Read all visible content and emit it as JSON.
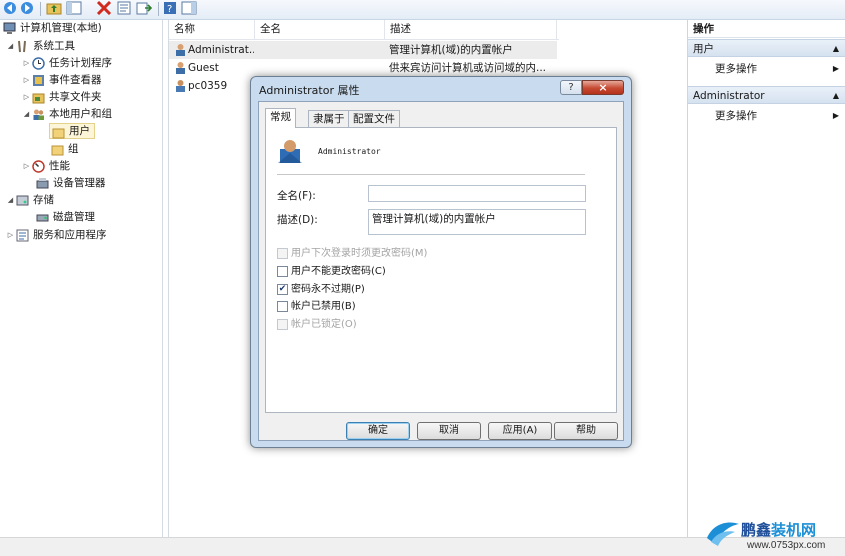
{
  "colors": {
    "selection_bg": "#fdf5d8",
    "action_group_bg": "#d6e2f0",
    "dialog_frame": "#c9dbee",
    "close_button": "#c64a32",
    "watermark_blue": "#1c8fd6"
  },
  "toolbar": {
    "icons": [
      "back-icon",
      "forward-icon",
      "up-folder-icon",
      "show-hide-tree-icon",
      "delete-icon",
      "properties-icon",
      "export-icon",
      "help-icon",
      "show-hide-action-pane-icon"
    ]
  },
  "tree": {
    "root": "计算机管理(本地)",
    "system_tools": "系统工具",
    "task_scheduler": "任务计划程序",
    "event_viewer": "事件查看器",
    "shared_folders": "共享文件夹",
    "local_users_groups": "本地用户和组",
    "users": "用户",
    "groups": "组",
    "performance": "性能",
    "device_manager": "设备管理器",
    "storage": "存储",
    "disk_management": "磁盘管理",
    "services_apps": "服务和应用程序"
  },
  "list": {
    "columns": [
      "名称",
      "全名",
      "描述"
    ],
    "rows": [
      {
        "name": "Administrat...",
        "fullname": "",
        "desc": "管理计算机(域)的内置帐户"
      },
      {
        "name": "Guest",
        "fullname": "",
        "desc": "供来宾访问计算机或访问域的内..."
      },
      {
        "name": "pc0359",
        "fullname": "",
        "desc": ""
      }
    ]
  },
  "actions": {
    "header": "操作",
    "groups": [
      {
        "title": "用户",
        "item": "更多操作"
      },
      {
        "title": "Administrator",
        "item": "更多操作"
      }
    ]
  },
  "dialog": {
    "title": "Administrator 属性",
    "help_glyph": "?",
    "close_glyph": "×",
    "tabs": [
      "常规",
      "隶属于",
      "配置文件"
    ],
    "username": "Administrator",
    "fullname_label": "全名(F):",
    "fullname_value": "",
    "description_label": "描述(D):",
    "description_value": "管理计算机(域)的内置帐户",
    "checkboxes": [
      {
        "label": "用户下次登录时须更改密码(M)",
        "checked": false,
        "enabled": false
      },
      {
        "label": "用户不能更改密码(C)",
        "checked": false,
        "enabled": true
      },
      {
        "label": "密码永不过期(P)",
        "checked": true,
        "enabled": true
      },
      {
        "label": "帐户已禁用(B)",
        "checked": false,
        "enabled": true
      },
      {
        "label": "帐户已锁定(O)",
        "checked": false,
        "enabled": false
      }
    ],
    "buttons": {
      "ok": "确定",
      "cancel": "取消",
      "apply": "应用(A)",
      "help": "帮助"
    }
  },
  "watermark": {
    "brand_plain": "鹏鑫",
    "brand_accent": "装机网",
    "url": "www.0753px.com"
  }
}
